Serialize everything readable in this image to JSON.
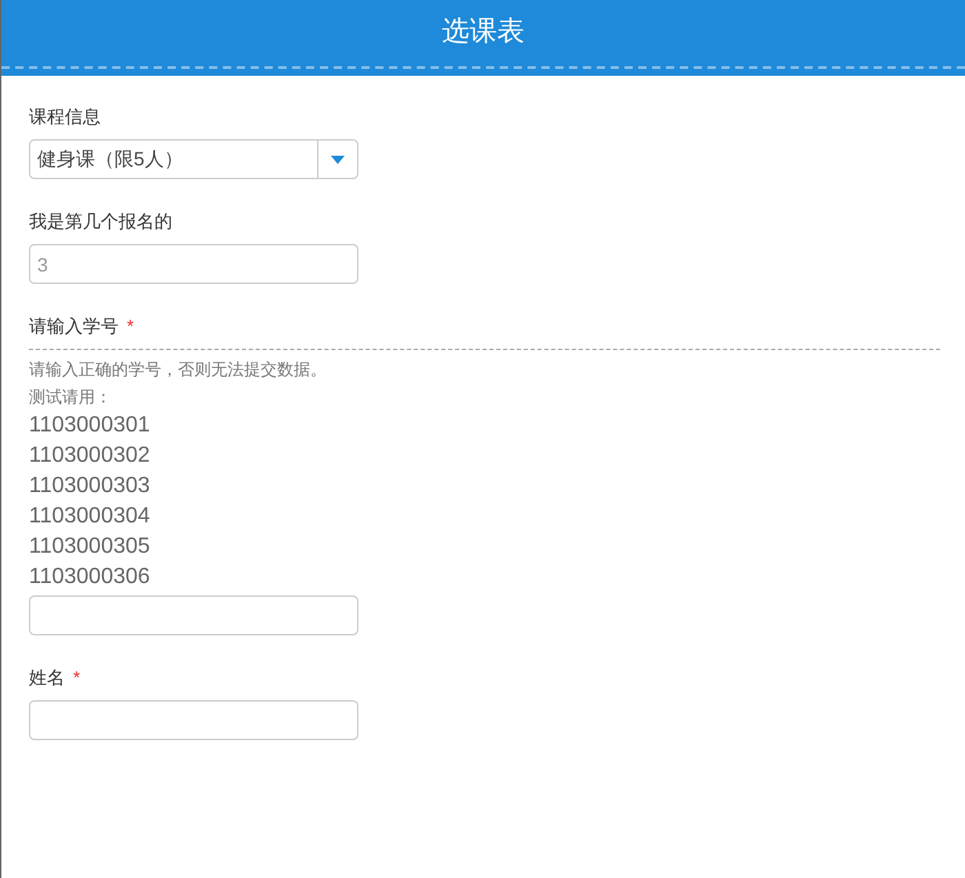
{
  "header": {
    "title": "选课表"
  },
  "fields": [
    {
      "kind": "select",
      "label": "课程信息",
      "value": "健身课（限5人）",
      "disabled": false
    },
    {
      "kind": "text",
      "label": "我是第几个报名的",
      "value": "3",
      "disabled": true
    },
    {
      "kind": "text",
      "label": "请输入学号",
      "required_mark": "*",
      "help": [
        "请输入正确的学号，否则无法提交数据。",
        "测试请用："
      ],
      "examples": [
        "1103000301",
        "1103000302",
        "1103000303",
        "1103000304",
        "1103000305",
        "1103000306"
      ]
    },
    {
      "kind": "text",
      "label": "姓名",
      "required_mark": "*"
    }
  ]
}
